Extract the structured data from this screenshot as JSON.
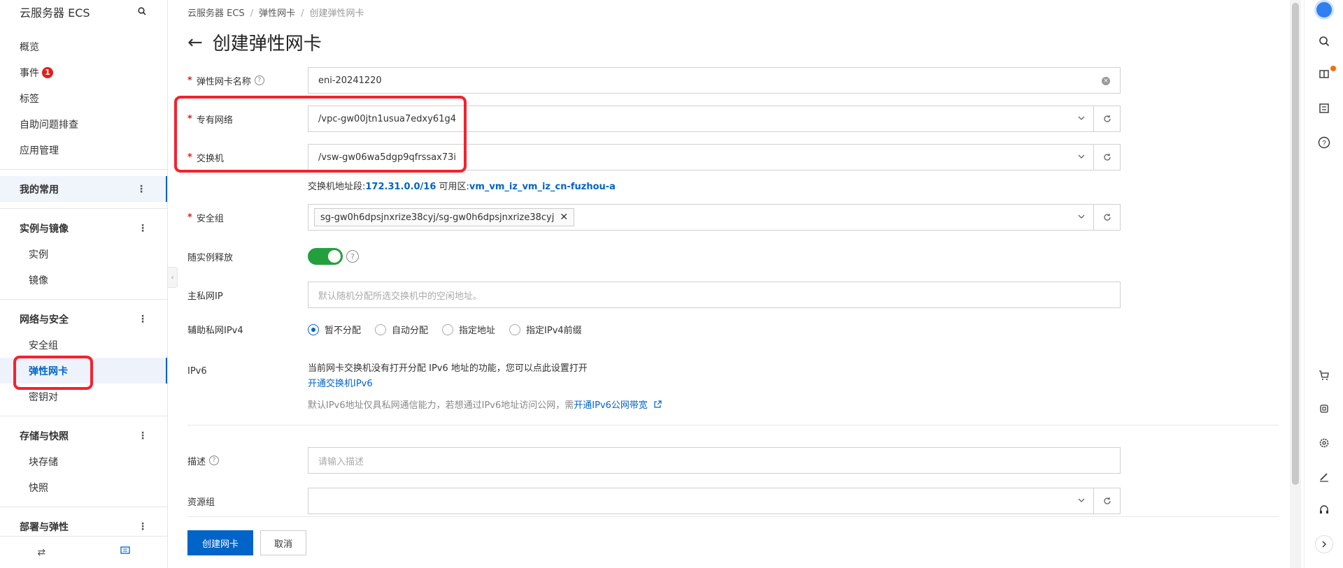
{
  "sidebar": {
    "title": "云服务器 ECS",
    "top_items": [
      {
        "label": "概览"
      },
      {
        "label": "事件",
        "badge": "1"
      },
      {
        "label": "标签"
      },
      {
        "label": "自助问题排查"
      },
      {
        "label": "应用管理"
      }
    ],
    "favorites": "我的常用",
    "groups": [
      {
        "title": "实例与镜像",
        "items": [
          "实例",
          "镜像"
        ]
      },
      {
        "title": "网络与安全",
        "items": [
          "安全组",
          "弹性网卡",
          "密钥对"
        ]
      },
      {
        "title": "存储与快照",
        "items": [
          "块存储",
          "快照"
        ]
      },
      {
        "title": "部署与弹性",
        "items": []
      }
    ],
    "active_item": "弹性网卡",
    "footer": {
      "left_icon": "swap-icon",
      "right_icon": "message-icon"
    }
  },
  "breadcrumb": [
    "云服务器 ECS",
    "弹性网卡",
    "创建弹性网卡"
  ],
  "page_title": "创建弹性网卡",
  "form": {
    "name": {
      "label": "弹性网卡名称",
      "value": "eni-20241220"
    },
    "vpc": {
      "label": "专有网络",
      "value": "/vpc-gw00jtn1usua7edxy61g4"
    },
    "vswitch": {
      "label": "交换机",
      "value": "/vsw-gw06wa5dgp9qfrssax73i"
    },
    "vswitch_hint": {
      "prefix": "交换机地址段:",
      "cidr": "172.31.0.0/16",
      "zone_label": " 可用区:",
      "zone": "vm_vm_iz_vm_iz_cn-fuzhou-a"
    },
    "security_group": {
      "label": "安全组",
      "tag": "sg-gw0h6dpsjnxrize38cyj/sg-gw0h6dpsjnxrize38cyj"
    },
    "release": {
      "label": "随实例释放",
      "enabled": true
    },
    "primary_ip": {
      "label": "主私网IP",
      "placeholder": "默认随机分配所选交换机中的空闲地址。"
    },
    "secondary_ipv4": {
      "label": "辅助私网IPv4",
      "options": [
        "暂不分配",
        "自动分配",
        "指定地址",
        "指定IPv4前缀"
      ],
      "selected": "暂不分配"
    },
    "ipv6": {
      "label": "IPv6",
      "line1": "当前网卡交换机没有打开分配 IPv6 地址的功能，您可以点此设置打开",
      "link1": "开通交换机IPv6",
      "note": "默认IPv6地址仅具私网通信能力，若想通过IPv6地址访问公网，需",
      "link2": "开通IPv6公网带宽"
    },
    "description": {
      "label": "描述",
      "placeholder": "请输入描述"
    },
    "resource_group": {
      "label": "资源组",
      "value": ""
    }
  },
  "buttons": {
    "create": "创建网卡",
    "cancel": "取消"
  },
  "colors": {
    "primary": "#0064c8",
    "required": "#e0201b",
    "toggle_on": "#23a03d",
    "highlight": "#f5222d"
  }
}
